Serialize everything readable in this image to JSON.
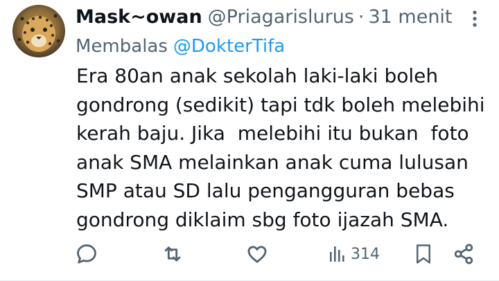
{
  "tweet": {
    "display_name": "Mask~owan",
    "handle": "@Priagarislurus",
    "separator": "·",
    "time": "31 menit",
    "reply_label": "Membalas",
    "reply_to": "@DokterTifa",
    "text": "Era 80an anak sekolah laki-laki boleh\ngondrong (sedikit) tapi tdk boleh melebihi\nkerah baju. Jika  melebihi itu bukan  foto\nanak SMA melainkan anak cuma lulusan\nSMP atau SD lalu pengangguran bebas\ngondrong diklaim sbg foto ijazah SMA."
  },
  "actions": {
    "views": "314"
  },
  "icons": {
    "avatar": "leopard-avatar",
    "more": "more-vertical-icon",
    "reply": "reply-icon",
    "retweet": "retweet-icon",
    "like": "heart-icon",
    "views": "views-bar-chart-icon",
    "bookmark": "bookmark-icon",
    "share": "share-icon"
  },
  "colors": {
    "text": "#0f1419",
    "secondary": "#536471",
    "link": "#1d9bf0"
  }
}
